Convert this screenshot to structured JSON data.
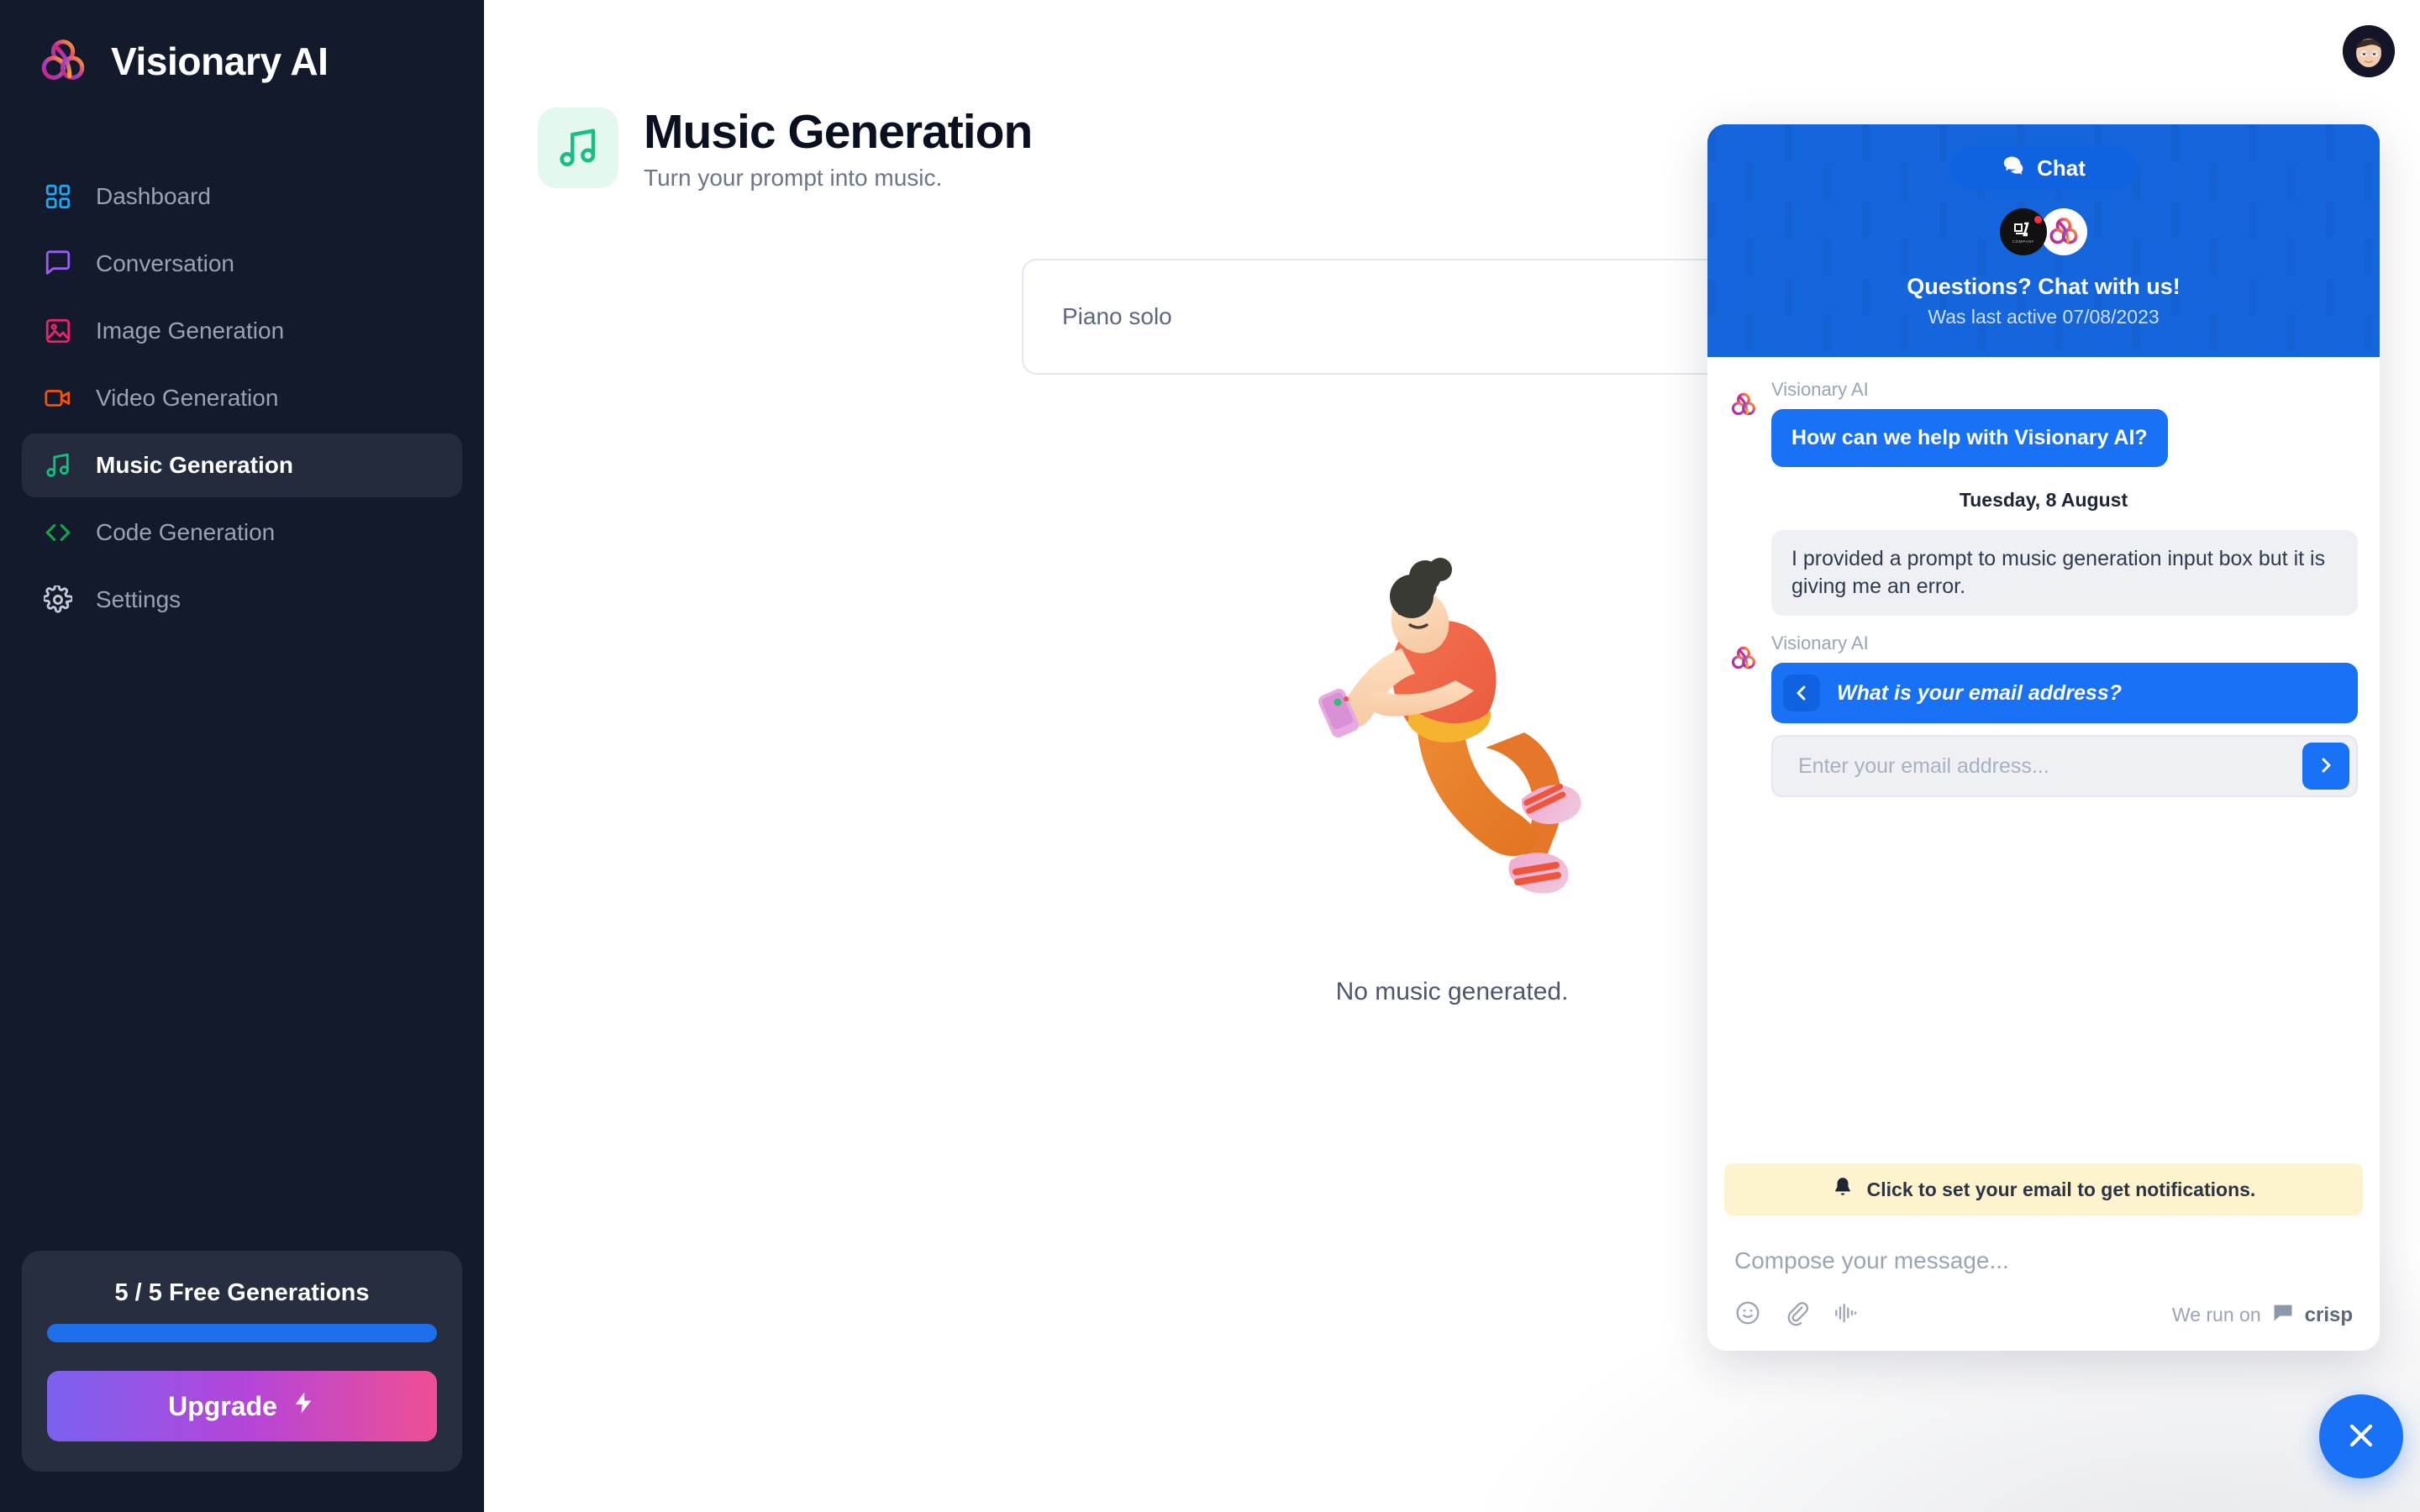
{
  "brand": {
    "name": "Visionary AI",
    "logo_icon": "trefoil-logo-icon"
  },
  "sidebar": {
    "items": [
      {
        "label": "Dashboard",
        "icon": "grid-icon",
        "color": "#22a7f0",
        "active": false
      },
      {
        "label": "Conversation",
        "icon": "chat-bubble-icon",
        "color": "#9a5cf5",
        "active": false
      },
      {
        "label": "Image Generation",
        "icon": "image-icon",
        "color": "#e8246b",
        "active": false
      },
      {
        "label": "Video Generation",
        "icon": "video-icon",
        "color": "#f0520f",
        "active": false
      },
      {
        "label": "Music Generation",
        "icon": "music-note-icon",
        "color": "#13c07a",
        "active": true
      },
      {
        "label": "Code Generation",
        "icon": "code-brackets-icon",
        "color": "#16a34a",
        "active": false
      },
      {
        "label": "Settings",
        "icon": "gear-icon",
        "color": "#c5ccd8",
        "active": false
      }
    ],
    "upgrade_card": {
      "generations_label": "5 / 5 Free Generations",
      "progress_percent": 100,
      "progress_color": "#1f6feb",
      "upgrade_label": "Upgrade",
      "upgrade_icon": "lightning-bolt-icon"
    }
  },
  "main": {
    "page_icon": "music-note-icon",
    "title": "Music Generation",
    "subtitle": "Turn your prompt into music.",
    "prompt_value": "Piano solo",
    "prompt_placeholder": "Piano solo",
    "empty_state_text": "No music generated.",
    "empty_illustration": "floating-person-with-phone-illustration",
    "avatar": "user-avatar"
  },
  "chat": {
    "tab_label": "Chat",
    "tab_icon": "chat-bubbles-icon",
    "title": "Questions? Chat with us!",
    "subtitle": "Was last active 07/08/2023",
    "operators": [
      "hi-company-avatar",
      "visionary-ai-avatar"
    ],
    "messages": [
      {
        "type": "agent",
        "author": "Visionary AI",
        "text": "How can we help with Visionary AI?"
      },
      {
        "type": "day",
        "text": "Tuesday, 8 August"
      },
      {
        "type": "user",
        "text": "I provided a prompt to music generation input box but it is giving me an error."
      },
      {
        "type": "question",
        "author": "Visionary AI",
        "text": "What is your email address?"
      }
    ],
    "email_placeholder": "Enter your email address...",
    "email_value": "",
    "email_send_icon": "chevron-right-icon",
    "question_back_icon": "chevron-left-icon",
    "notification": {
      "icon": "bell-icon",
      "text": "Click to set your email to get notifications."
    },
    "compose_placeholder": "Compose your message...",
    "tools": [
      "emoji-icon",
      "attachment-icon",
      "audio-waveform-icon"
    ],
    "powered_by_prefix": "We run on",
    "powered_by_brand": "crisp",
    "close_icon": "close-icon",
    "accent_color": "#1972f5"
  }
}
